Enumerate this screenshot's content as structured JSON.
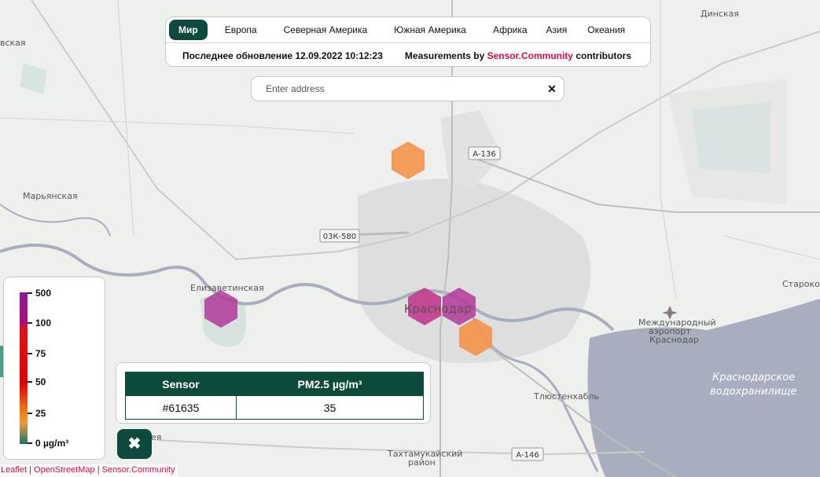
{
  "nav": {
    "tabs": [
      "Мир",
      "Европа",
      "Северная Америка",
      "Южная Америка",
      "Африка",
      "Азия",
      "Океания"
    ],
    "active_tab": "Мир",
    "last_update": "Последнее обновление 12.09.2022 10:12:23",
    "credit_prefix": "Measurements by",
    "credit_link": "Sensor.Community",
    "credit_suffix": "contributors"
  },
  "search": {
    "placeholder": "Enter address",
    "clear_icon": "close-icon"
  },
  "legend": {
    "labels": [
      "500",
      "100",
      "75",
      "50",
      "25",
      "0 µg/m³"
    ]
  },
  "popup": {
    "headers": [
      "Sensor",
      "PM2.5 µg/m³"
    ],
    "sensor_id": "#61635",
    "pm25": "35"
  },
  "close_button": {
    "icon": "close-icon",
    "glyph": "✖"
  },
  "attribution": {
    "items": [
      "Leaflet",
      "OpenStreetMap",
      "Sensor.Community"
    ],
    "separator": "|"
  },
  "map": {
    "place_labels": {
      "dinskaya": "Динская",
      "vskaya": "вская",
      "maryanskaya": "Марьянская",
      "elizavetinskaya": "Елизаветинская",
      "krasnodar": "Краснодар",
      "starokor": "Старокор",
      "airport": [
        "Международный",
        "аэропорт",
        "Краснодар"
      ],
      "reservoir": [
        "Краснодарское",
        "водохранилище"
      ],
      "tlyustenkhabl": "Тлюстенхабль",
      "takhtamukay": [
        "Тахтамукайский",
        "район"
      ],
      "eya": "ея"
    },
    "road_shields": [
      "А-136",
      "03К-580",
      "А-146"
    ],
    "colors": {
      "accent": "#0d4a3e",
      "link": "#d10a4b",
      "hex_orange": "#f4934a",
      "hex_purple": "#b23a9a",
      "hex_magenta": "#c0308a",
      "water": "#a9aebf"
    }
  }
}
